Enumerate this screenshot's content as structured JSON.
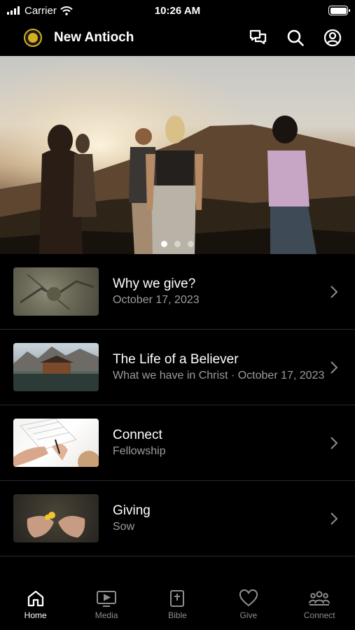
{
  "status_bar": {
    "carrier": "Carrier",
    "time": "10:26 AM"
  },
  "header": {
    "title": "New Antioch"
  },
  "hero": {
    "slides": 3,
    "active_slide": 1
  },
  "list": [
    {
      "title": "Why we give?",
      "subtitle": "October 17, 2023",
      "thumb": "aerial-ground"
    },
    {
      "title": "The Life of a Believer",
      "subtitle": "What we have in Christ · October 17, 2023",
      "thumb": "lake-cabin"
    },
    {
      "title": "Connect",
      "subtitle": "Fellowship",
      "thumb": "hands-writing"
    },
    {
      "title": "Giving",
      "subtitle": "Sow",
      "thumb": "hands-flower"
    }
  ],
  "tabs": [
    {
      "label": "Home",
      "icon": "home-icon",
      "active": true
    },
    {
      "label": "Media",
      "icon": "tv-play-icon",
      "active": false
    },
    {
      "label": "Bible",
      "icon": "bible-icon",
      "active": false
    },
    {
      "label": "Give",
      "icon": "heart-icon",
      "active": false
    },
    {
      "label": "Connect",
      "icon": "group-icon",
      "active": false
    }
  ],
  "colors": {
    "background": "#000000",
    "subtitle": "#9c9c9c",
    "tab_inactive": "#8e8e8e",
    "logo_gold": "#d4b021"
  }
}
